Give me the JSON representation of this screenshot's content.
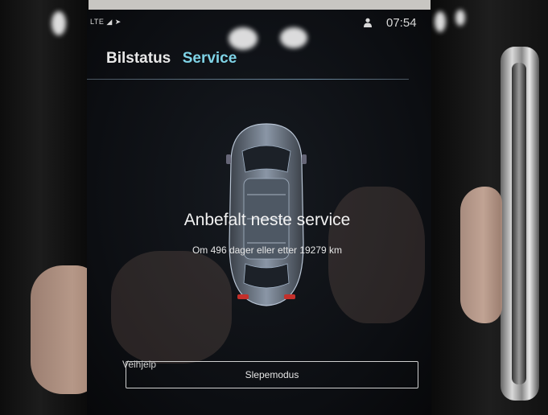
{
  "status_bar": {
    "signal_label": "LTE",
    "time": "07:54"
  },
  "tabs": [
    {
      "label": "Bilstatus",
      "active": false
    },
    {
      "label": "Service",
      "active": true
    }
  ],
  "service": {
    "title": "Anbefalt neste service",
    "subtitle": "Om 496 dager eller etter 19279 km"
  },
  "veihjelp": {
    "heading": "Veihjelp",
    "button_label": "Slepemodus"
  },
  "colors": {
    "accent": "#7fd3e6",
    "screen_bg": "#0c0e12",
    "text": "#f2f2f2"
  }
}
